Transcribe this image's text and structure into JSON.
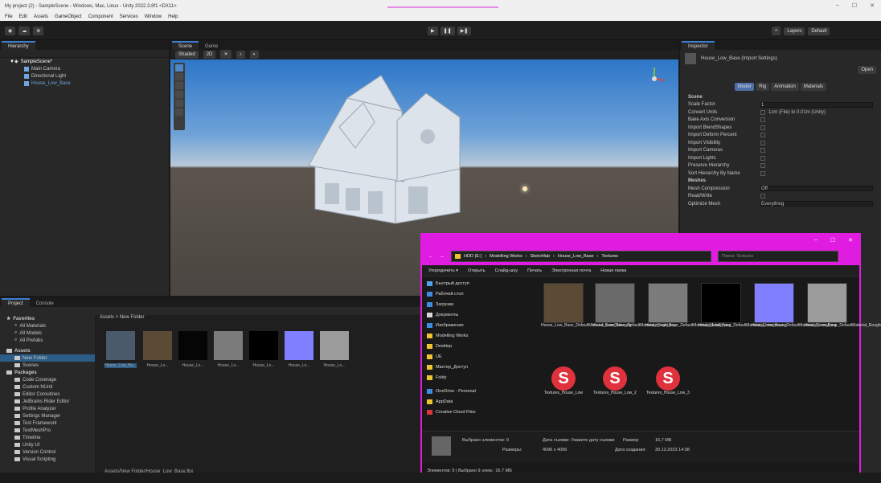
{
  "window": {
    "title": "My project (2) - SampleScene - Windows, Mac, Linux - Unity 2022.3.8f1 <DX11>",
    "controls": [
      "–",
      "☐",
      "✕"
    ]
  },
  "menu": [
    "File",
    "Edit",
    "Assets",
    "GameObject",
    "Component",
    "Services",
    "Window",
    "Help"
  ],
  "toolbar": {
    "account": "Account",
    "layout": "Default",
    "layers": "Layers"
  },
  "hierarchy": {
    "tab": "Hierarchy",
    "items": [
      {
        "label": "SampleScene*",
        "depth": 0
      },
      {
        "label": "Main Camera",
        "depth": 1
      },
      {
        "label": "Directional Light",
        "depth": 1
      },
      {
        "label": "House_Low_Base",
        "depth": 1
      }
    ]
  },
  "scene": {
    "tabs": [
      "Scene",
      "Game"
    ],
    "mode_buttons": [
      "Shaded",
      "2D"
    ]
  },
  "inspector": {
    "tab": "Inspector",
    "object_name": "House_Low_Base (Import Settings)",
    "open_button": "Open",
    "sections": [
      "Model",
      "Rig",
      "Animation",
      "Materials"
    ],
    "header": "Scene",
    "rows": [
      {
        "label": "Scale Factor",
        "value": "1"
      },
      {
        "label": "Convert Units",
        "value": "1cm (File) to 0.01m (Unity)"
      },
      {
        "label": "Bake Axis Conversion",
        "value": ""
      },
      {
        "label": "Import BlendShapes",
        "value": ""
      },
      {
        "label": "Import Deform Percent",
        "value": ""
      },
      {
        "label": "Import Visibility",
        "value": ""
      },
      {
        "label": "Import Cameras",
        "value": ""
      },
      {
        "label": "Import Lights",
        "value": ""
      },
      {
        "label": "Preserve Hierarchy",
        "value": ""
      },
      {
        "label": "Sort Hierarchy By Name",
        "value": ""
      }
    ],
    "mesh_header": "Meshes",
    "mesh_rows": [
      {
        "label": "Mesh Compression",
        "value": "Off"
      },
      {
        "label": "Read/Write",
        "value": ""
      },
      {
        "label": "Optimize Mesh",
        "value": "Everything"
      }
    ]
  },
  "project": {
    "tabs": [
      "Project",
      "Console"
    ],
    "tree": [
      {
        "label": "Favorites",
        "depth": 0
      },
      {
        "label": "All Materials",
        "depth": 1
      },
      {
        "label": "All Models",
        "depth": 1
      },
      {
        "label": "All Prefabs",
        "depth": 1
      },
      {
        "label": "Assets",
        "depth": 0
      },
      {
        "label": "New Folder",
        "depth": 1
      },
      {
        "label": "Scenes",
        "depth": 1
      },
      {
        "label": "Packages",
        "depth": 0
      },
      {
        "label": "Code Coverage",
        "depth": 1
      },
      {
        "label": "Custom NUnit",
        "depth": 1
      },
      {
        "label": "Editor Coroutines",
        "depth": 1
      },
      {
        "label": "JetBrains Rider Editor",
        "depth": 1
      },
      {
        "label": "Profile Analyzer",
        "depth": 1
      },
      {
        "label": "Settings Manager",
        "depth": 1
      },
      {
        "label": "Test Framework",
        "depth": 1
      },
      {
        "label": "TextMeshPro",
        "depth": 1
      },
      {
        "label": "Timeline",
        "depth": 1
      },
      {
        "label": "Unity UI",
        "depth": 1
      },
      {
        "label": "Version Control",
        "depth": 1
      },
      {
        "label": "Visual Scripting",
        "depth": 1
      }
    ],
    "breadcrumb": "Assets > New Folder",
    "thumbs": [
      "House_Low_Ba...",
      "House_Lo...",
      "House_Lo...",
      "House_Lo...",
      "House_Lo...",
      "House_Lo...",
      "House_Lo..."
    ],
    "footer_path": "Assets/New Folder/House_Low_Base.fbx"
  },
  "explorer": {
    "path": [
      "HDD (E:)",
      "Modelling Works",
      "Sketchfab",
      "House_Low_Base",
      "Textures"
    ],
    "search_placeholder": "Поиск: Textures",
    "ribbon": [
      "Упорядочить ▾",
      "Открыть",
      "Слайд-шоу",
      "Печать",
      "Электронная почта",
      "Новая папка"
    ],
    "nav": [
      {
        "label": "Быстрый доступ",
        "color": "#4fa3f0"
      },
      {
        "label": "Рабочий стол",
        "color": "#3c8de0"
      },
      {
        "label": "Загрузки",
        "color": "#3c8de0"
      },
      {
        "label": "Документы",
        "color": "#d9d9d9"
      },
      {
        "label": "Изображения",
        "color": "#3c8de0"
      },
      {
        "label": "Modelling Works",
        "color": "#f0c330"
      },
      {
        "label": "Desktop",
        "color": "#f0c330"
      },
      {
        "label": "UE",
        "color": "#f0c330"
      },
      {
        "label": "Мастер_Доступ",
        "color": "#f0c330"
      },
      {
        "label": "Foldy",
        "color": "#f0c330"
      },
      {
        "label": "OneDrive - Personal",
        "color": "#3c8de0"
      },
      {
        "label": "AppData",
        "color": "#f0c330"
      },
      {
        "label": "Creative Cloud Files",
        "color": "#e0323c"
      }
    ],
    "files": [
      {
        "label": "House_Low_Base_DefaultMaterial_BaseColor.png",
        "swatch": "#5a4a36"
      },
      {
        "label": "House_Low_Base_DefaultMaterial_Height.png",
        "swatch": "#6a6a6a"
      },
      {
        "label": "House_Low_Base_DefaultMaterial_Metallic.png",
        "swatch": "#7b7b7b"
      },
      {
        "label": "House_Low_Base_DefaultMaterial_Emissive.png",
        "swatch": "#000000"
      },
      {
        "label": "House_Low_Base_DefaultMaterial_Normal.png",
        "swatch": "#7f7fff"
      },
      {
        "label": "House_Low_Base_DefaultMaterial_Roughness.png",
        "swatch": "#9b9b9b"
      },
      {
        "label": "Textures_House_Low",
        "swatch": "#e0323c"
      },
      {
        "label": "Textures_House_Low_2",
        "swatch": "#e0323c"
      },
      {
        "label": "Textures_House_Low_3",
        "swatch": "#e0323c"
      }
    ],
    "details": {
      "selected": "Выбрано элементов: 9",
      "taken": "Дата съемки: Укажите дату съемки",
      "size_label": "Размер:",
      "size": "16,7 МБ",
      "dims_label": "Размеры:",
      "dims": "4096 x 4096",
      "created_label": "Дата создания:",
      "created": "30.12.2023 14:08"
    },
    "status": "Элементов: 9 | Выбрано 9 элем.: 16,7 МБ"
  },
  "colors": {
    "highlight": "#e11ce1",
    "accent": "#3c7fd0",
    "substance": "#e0323c"
  }
}
